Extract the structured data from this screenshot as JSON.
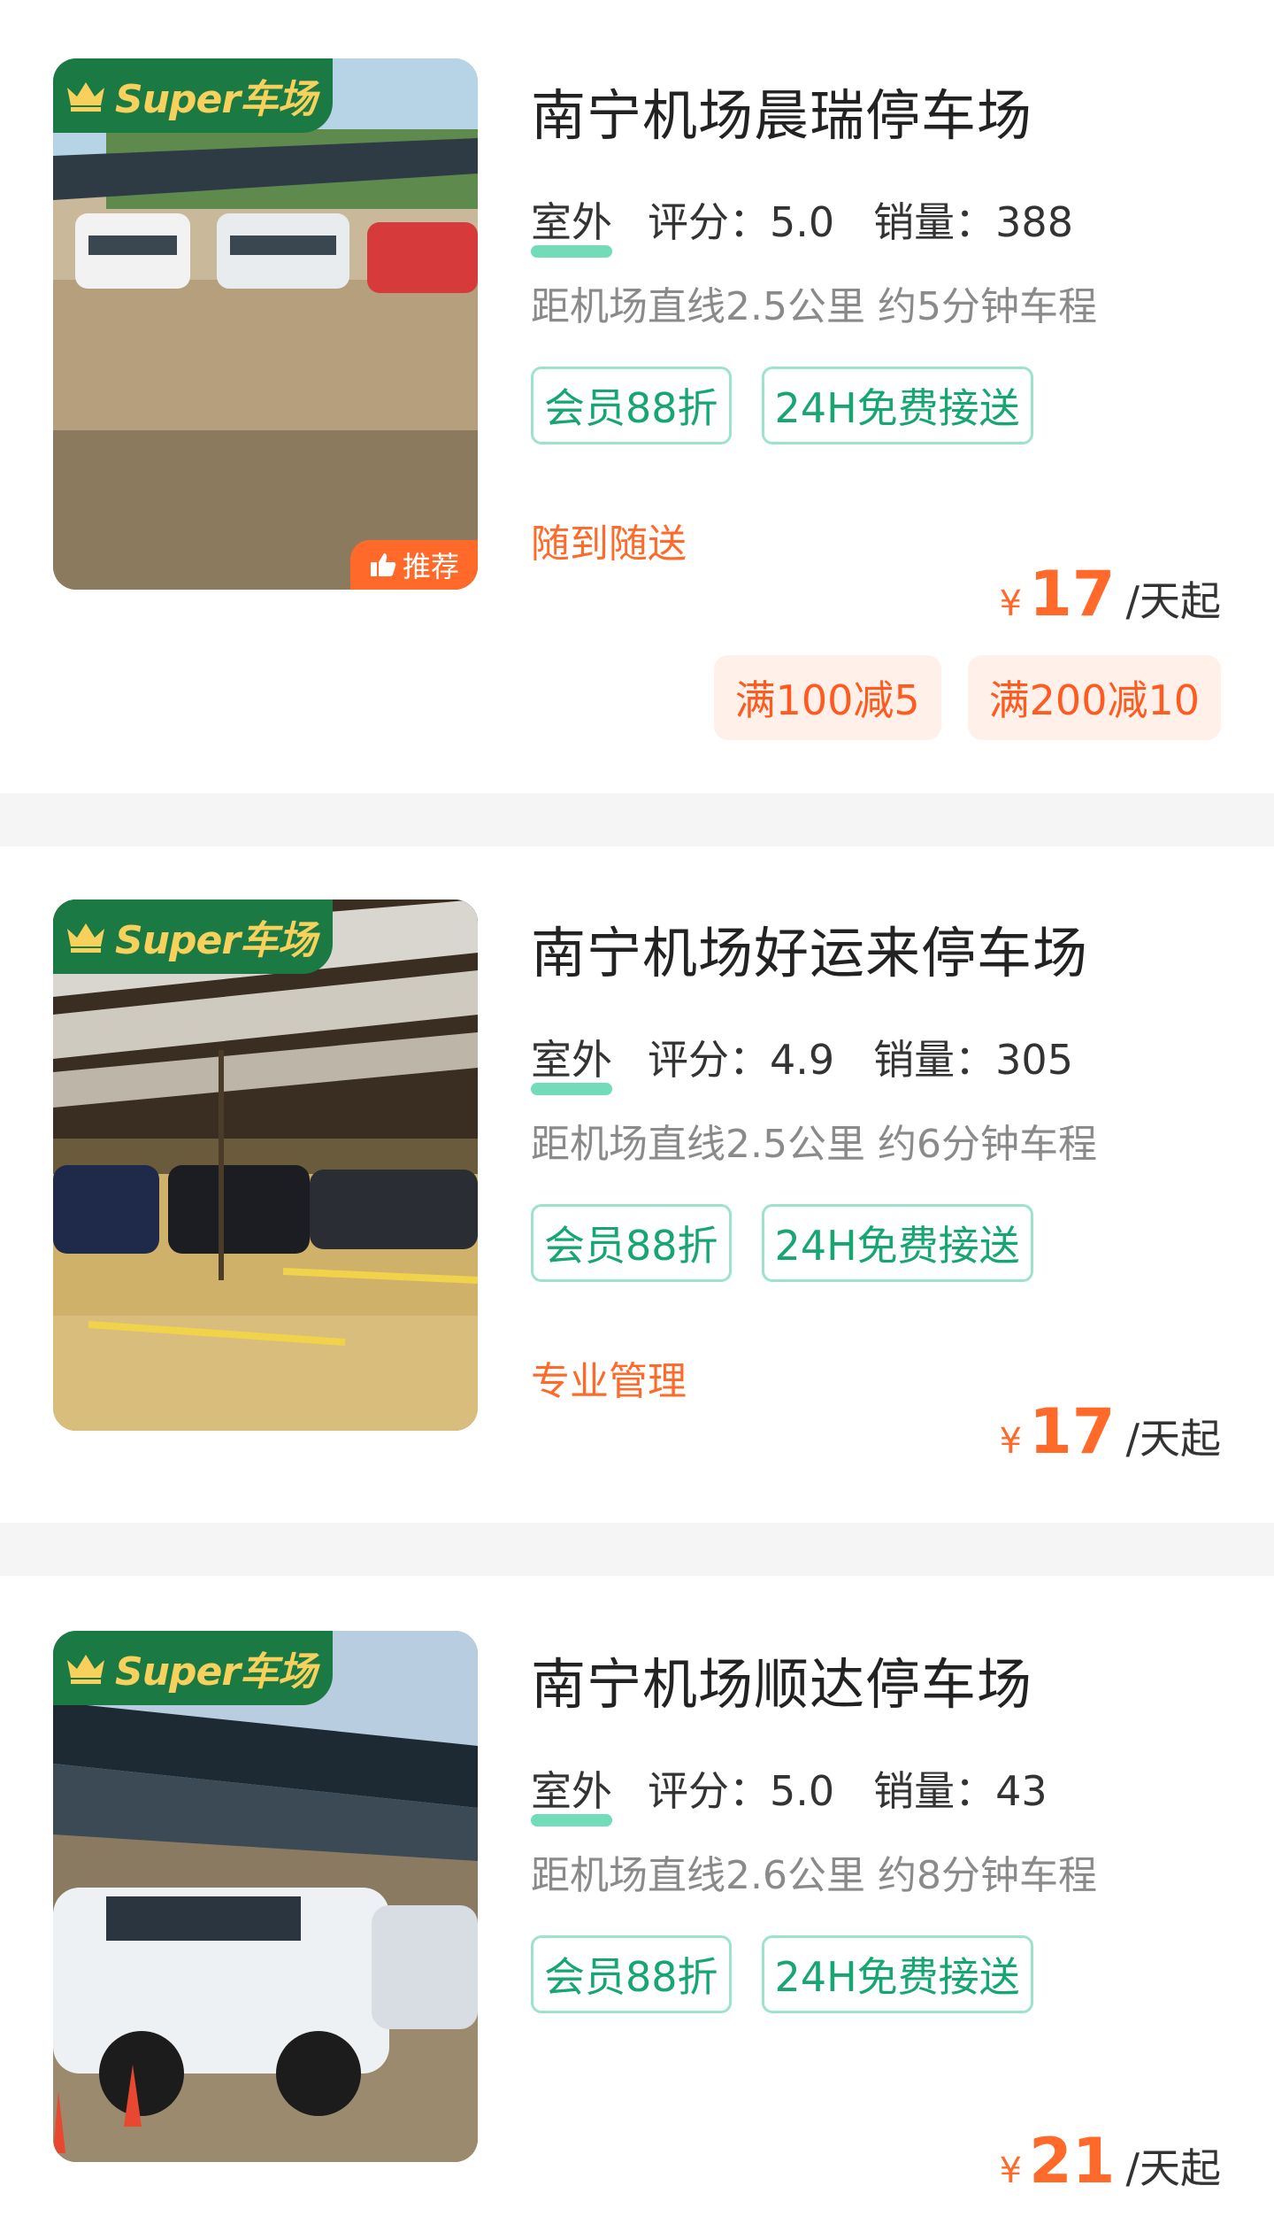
{
  "listings": [
    {
      "badge": "Super车场",
      "recommend": "推荐",
      "title": "南宁机场晨瑞停车场",
      "environment": "室外",
      "rating_label": "评分：",
      "rating": "5.0",
      "sales_label": "销量：",
      "sales": "388",
      "distance": "距机场直线2.5公里 约5分钟车程",
      "tags": [
        "会员88折",
        "24H免费接送"
      ],
      "feature": "随到随送",
      "currency": "¥",
      "price": "17",
      "price_unit": "/天起",
      "coupons": [
        "满100减5",
        "满200减10"
      ]
    },
    {
      "badge": "Super车场",
      "title": "南宁机场好运来停车场",
      "environment": "室外",
      "rating_label": "评分：",
      "rating": "4.9",
      "sales_label": "销量：",
      "sales": "305",
      "distance": "距机场直线2.5公里 约6分钟车程",
      "tags": [
        "会员88折",
        "24H免费接送"
      ],
      "feature": "专业管理",
      "currency": "¥",
      "price": "17",
      "price_unit": "/天起"
    },
    {
      "badge": "Super车场",
      "title": "南宁机场顺达停车场",
      "environment": "室外",
      "rating_label": "评分：",
      "rating": "5.0",
      "sales_label": "销量：",
      "sales": "43",
      "distance": "距机场直线2.6公里 约8分钟车程",
      "tags": [
        "会员88折",
        "24H免费接送"
      ],
      "currency": "¥",
      "price": "21",
      "price_unit": "/天起"
    }
  ],
  "colors": {
    "accent_orange": "#ff6a2a",
    "tag_green": "#16a672",
    "badge_green": "#1b7a43",
    "badge_gold": "#f8d15c",
    "divider": "#f5f5f5"
  },
  "icons": [
    "crown-icon",
    "thumbs-up-icon"
  ]
}
